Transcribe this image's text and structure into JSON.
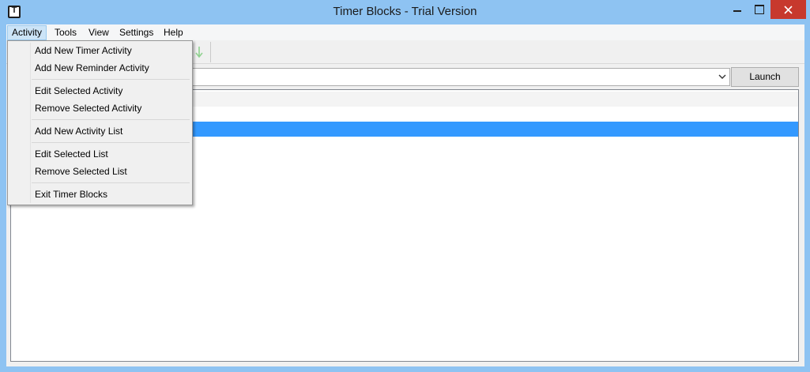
{
  "window": {
    "title": "Timer Blocks - Trial Version",
    "app_icon_letter": "T"
  },
  "menubar": {
    "items": [
      {
        "label": "Activity",
        "open": true
      },
      {
        "label": "Tools"
      },
      {
        "label": "View"
      },
      {
        "label": "Settings"
      },
      {
        "label": "Help"
      }
    ]
  },
  "activity_menu": {
    "items": [
      {
        "label": "Add New Timer Activity"
      },
      {
        "label": "Add New Reminder Activity"
      },
      {
        "label": "Edit Selected Activity"
      },
      {
        "label": "Remove Selected Activity"
      },
      {
        "label": "Add New Activity List"
      },
      {
        "label": "Edit Selected List"
      },
      {
        "label": "Remove Selected List"
      },
      {
        "label": "Exit Timer Blocks"
      }
    ]
  },
  "list_selector": {
    "selected": ""
  },
  "launch_button": {
    "label": "Launch"
  },
  "toolbar": {
    "move_down_icon": "arrow-down-icon"
  },
  "colors": {
    "titlebar": "#8ec3f2",
    "close_button": "#c7392d",
    "selection": "#3399ff",
    "menu_highlight": "#cce4f7"
  }
}
